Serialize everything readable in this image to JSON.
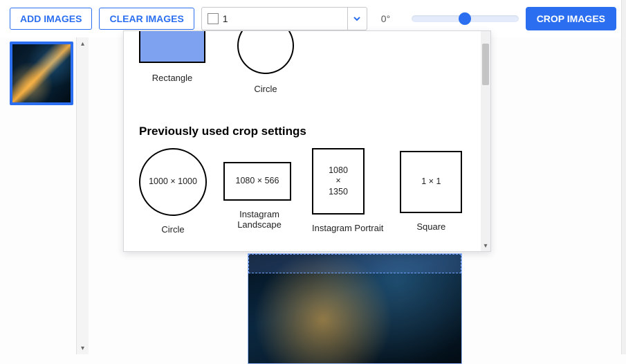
{
  "toolbar": {
    "add_images": "ADD IMAGES",
    "clear_images": "CLEAR IMAGES",
    "ratio_value": "1",
    "angle_readout": "0°",
    "crop_images": "CROP IMAGES"
  },
  "dropdown": {
    "basic_shapes": [
      {
        "label": "Rectangle"
      },
      {
        "label": "Circle"
      }
    ],
    "section_title": "Previously used crop settings",
    "previous": [
      {
        "label": "Circle",
        "text": "1000 × 1000",
        "shape": "circle"
      },
      {
        "label": "Instagram Landscape",
        "text": "1080 × 566",
        "shape": "landscape"
      },
      {
        "label": "Instagram Portrait",
        "text": "1080\n×\n1350",
        "shape": "portrait"
      },
      {
        "label": "Square",
        "text": "1 × 1",
        "shape": "square"
      }
    ]
  }
}
